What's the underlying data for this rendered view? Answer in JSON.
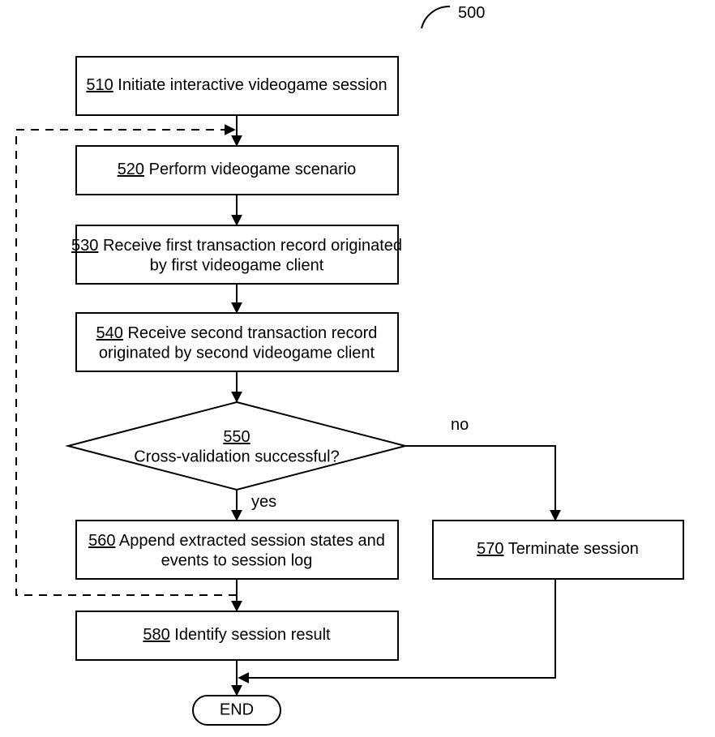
{
  "figure_ref": "500",
  "nodes": {
    "n510": {
      "num": "510",
      "text": "Initiate interactive videogame session"
    },
    "n520": {
      "num": "520",
      "text": "Perform videogame scenario"
    },
    "n530": {
      "num": "530",
      "line1": "Receive first transaction record originated",
      "line2": "by first videogame client"
    },
    "n540": {
      "num": "540",
      "line1": "Receive second transaction record",
      "line2": "originated by second videogame client"
    },
    "n550": {
      "num": "550",
      "text": "Cross-validation successful?"
    },
    "n560": {
      "num": "560",
      "line1": "Append extracted session states and",
      "line2": "events to session log"
    },
    "n570": {
      "num": "570",
      "text": "Terminate session"
    },
    "n580": {
      "num": "580",
      "text": "Identify session result"
    }
  },
  "labels": {
    "yes": "yes",
    "no": "no",
    "end": "END"
  }
}
